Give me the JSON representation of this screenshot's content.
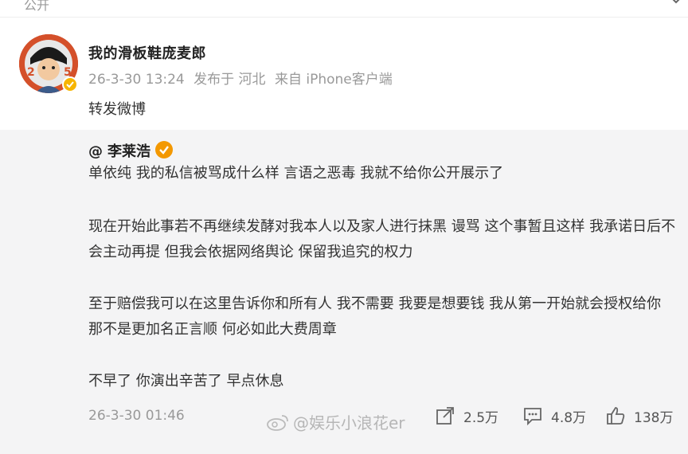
{
  "topbar": {
    "label": "公开"
  },
  "post": {
    "author": "我的滑板鞋庞麦郎",
    "time": "26-3-30 13:24",
    "location": "发布于 河北",
    "source": "来自 iPhone客户端",
    "text": "转发微博"
  },
  "quoted": {
    "at": "@",
    "author": "李莱浩",
    "paragraphs": [
      "单依纯 我的私信被骂成什么样 言语之恶毒 我就不给你公开展示了",
      "现在开始此事若不再继续发酵对我本人以及家人进行抹黑 谩骂 这个事暂且这样 我承诺日后不会主动再提 但我会依据网络舆论 保留我追究的权力",
      "至于赔偿我可以在这里告诉你和所有人 我不需要 我要是想要钱 我从第一开始就会授权给你 那不是更加名正言顺 何必如此大费周章",
      "不早了 你演出辛苦了 早点休息"
    ],
    "time": "26-3-30 01:46",
    "reposts": "2.5万",
    "comments": "4.8万",
    "likes": "138万"
  },
  "watermark": "@娱乐小浪花er",
  "colors": {
    "verified_gold": "#f7b500",
    "verified_orange": "#f39800",
    "meta_gray": "#999999"
  }
}
